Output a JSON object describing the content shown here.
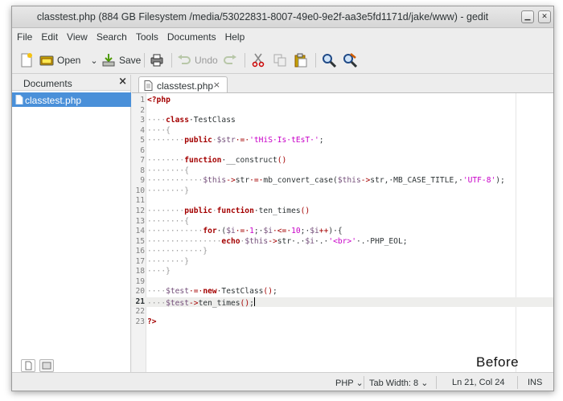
{
  "window": {
    "title": "classtest.php (884 GB Filesystem /media/53022831-8007-49e0-9e2f-aa3e5fd1171d/jake/www) - gedit",
    "minimize_glyph": "▁",
    "close_glyph": "✕"
  },
  "menu": [
    "File",
    "Edit",
    "View",
    "Search",
    "Tools",
    "Documents",
    "Help"
  ],
  "toolbar": {
    "new_icon": "new-document-icon",
    "open_label": "Open",
    "open_dropdown_glyph": "⌄",
    "save_label": "Save",
    "print_icon": "print-icon",
    "undo_label": "Undo",
    "redo_icon": "redo-icon",
    "cut_icon": "cut-icon",
    "copy_icon": "copy-icon",
    "paste_icon": "paste-icon",
    "find_icon": "find-icon",
    "replace_icon": "find-replace-icon"
  },
  "side_panel": {
    "title": "Documents",
    "close_glyph": "×",
    "documents": [
      "classtest.php"
    ]
  },
  "tab": {
    "label": "classtest.php",
    "close_glyph": "×"
  },
  "editor": {
    "current_line": 21,
    "lines": [
      [
        [
          "<?php",
          "kw"
        ]
      ],
      [],
      [
        [
          "····",
          "ws"
        ],
        [
          "class",
          "kw"
        ],
        [
          "·TestClass",
          "tx"
        ]
      ],
      [
        [
          "····{",
          "ws"
        ]
      ],
      [
        [
          "········",
          "ws"
        ],
        [
          "public",
          "kw"
        ],
        [
          "·",
          "ws"
        ],
        [
          "$str",
          "var"
        ],
        [
          "·=·",
          "op"
        ],
        [
          "'tHiS·Is·tEsT·'",
          "str"
        ],
        [
          ";",
          "tx"
        ]
      ],
      [],
      [
        [
          "········",
          "ws"
        ],
        [
          "function",
          "kw"
        ],
        [
          "·__construct",
          "tx"
        ],
        [
          "()",
          "op"
        ]
      ],
      [
        [
          "········{",
          "ws"
        ]
      ],
      [
        [
          "············",
          "ws"
        ],
        [
          "$this",
          "var"
        ],
        [
          "->",
          "op"
        ],
        [
          "str",
          "tx"
        ],
        [
          "·=·",
          "op"
        ],
        [
          "mb_convert_case(",
          "tx"
        ],
        [
          "$this",
          "var"
        ],
        [
          "->",
          "op"
        ],
        [
          "str,·MB_CASE_TITLE,·",
          "tx"
        ],
        [
          "'UTF-8'",
          "str"
        ],
        [
          ");",
          "tx"
        ]
      ],
      [
        [
          "········}",
          "ws"
        ]
      ],
      [],
      [
        [
          "········",
          "ws"
        ],
        [
          "public",
          "kw"
        ],
        [
          "·",
          "ws"
        ],
        [
          "function",
          "kw"
        ],
        [
          "·ten_times",
          "tx"
        ],
        [
          "()",
          "op"
        ]
      ],
      [
        [
          "········{",
          "ws"
        ]
      ],
      [
        [
          "············",
          "ws"
        ],
        [
          "for",
          "kw"
        ],
        [
          "·(",
          "tx"
        ],
        [
          "$i",
          "var"
        ],
        [
          "·=·",
          "op"
        ],
        [
          "1",
          "num"
        ],
        [
          ";·",
          "tx"
        ],
        [
          "$i",
          "var"
        ],
        [
          "·<=·",
          "op"
        ],
        [
          "10",
          "num"
        ],
        [
          ";·",
          "tx"
        ],
        [
          "$i",
          "var"
        ],
        [
          "++",
          "op"
        ],
        [
          ")·{",
          "tx"
        ]
      ],
      [
        [
          "················",
          "ws"
        ],
        [
          "echo",
          "kw"
        ],
        [
          "·",
          "ws"
        ],
        [
          "$this",
          "var"
        ],
        [
          "->",
          "op"
        ],
        [
          "str·.·",
          "tx"
        ],
        [
          "$i",
          "var"
        ],
        [
          "·.·",
          "tx"
        ],
        [
          "'<br>'",
          "str"
        ],
        [
          "·.·PHP_EOL;",
          "tx"
        ]
      ],
      [
        [
          "············}",
          "ws"
        ]
      ],
      [
        [
          "········}",
          "ws"
        ]
      ],
      [
        [
          "····}",
          "ws"
        ]
      ],
      [],
      [
        [
          "····",
          "ws"
        ],
        [
          "$test",
          "var"
        ],
        [
          "·=·",
          "op"
        ],
        [
          "new",
          "kw"
        ],
        [
          "·TestClass",
          "tx"
        ],
        [
          "()",
          "op"
        ],
        [
          ";",
          "tx"
        ]
      ],
      [
        [
          "····",
          "ws"
        ],
        [
          "$test",
          "var"
        ],
        [
          "->",
          "op"
        ],
        [
          "ten_times",
          "tx"
        ],
        [
          "()",
          "op"
        ],
        [
          ";",
          "tx"
        ]
      ],
      [],
      [
        [
          "?>",
          "kw"
        ]
      ]
    ],
    "syntax_colors": {
      "kw": "#a40000",
      "var": "#75507b",
      "str": "#c800c8",
      "num": "#c800c8",
      "op": "#a40000",
      "tx": "#2e3436",
      "ws": "#9a9a9a"
    }
  },
  "overlay_label": "Before",
  "status": {
    "language": "PHP",
    "tab_width": "Tab Width: 8",
    "position": "Ln 21, Col 24",
    "mode": "INS",
    "dropdown_glyph": "⌄"
  },
  "colors": {
    "selection": "#4a90d9",
    "current_line": "#eeeeec"
  }
}
